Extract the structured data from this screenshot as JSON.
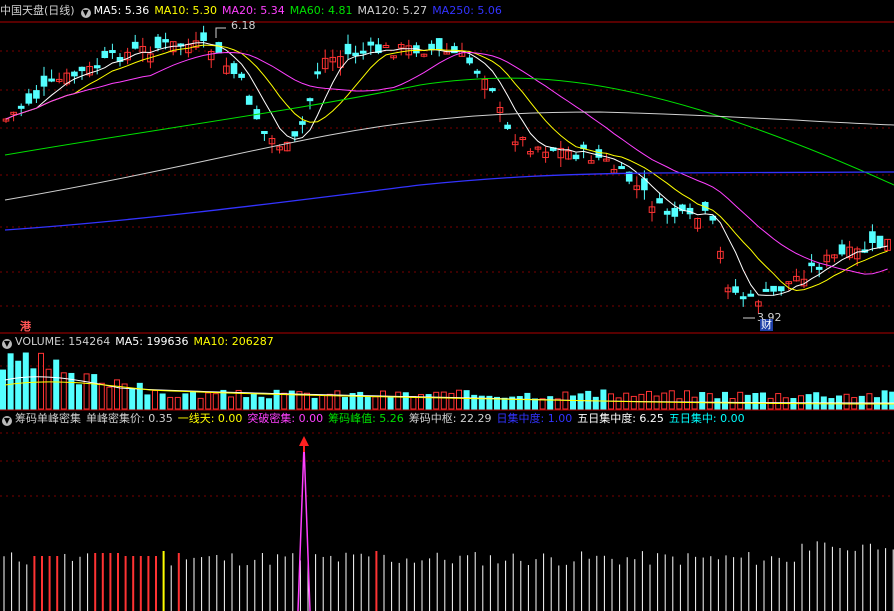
{
  "main": {
    "title": "中国天盘(日线)",
    "ma": [
      {
        "label": "MA5: 5.36",
        "color": "#ffffff"
      },
      {
        "label": "MA10: 5.30",
        "color": "#ffff00"
      },
      {
        "label": "MA20: 5.34",
        "color": "#ff40ff"
      },
      {
        "label": "MA60: 4.81",
        "color": "#00e000"
      },
      {
        "label": "MA120: 5.27",
        "color": "#d0d0d0"
      },
      {
        "label": "MA250: 5.06",
        "color": "#3333ff"
      }
    ],
    "high_label": "6.18",
    "low_label": "3.92",
    "tag_hk": "港",
    "tag_cai": "财"
  },
  "volume": {
    "title": "VOLUME: 154264",
    "ma5": "MA5: 199636",
    "ma10": "MA10: 206287"
  },
  "indicator": {
    "title": "筹码单峰密集",
    "items": [
      {
        "label": "单峰密集价: 0.35",
        "color": "#d0d0d0"
      },
      {
        "label": "一线天: 0.00",
        "color": "#ffff00"
      },
      {
        "label": "突破密集: 0.00",
        "color": "#ff40ff"
      },
      {
        "label": "筹码峰值: 5.26",
        "color": "#00e000"
      },
      {
        "label": "筹码中枢: 22.29",
        "color": "#d0d0d0"
      },
      {
        "label": "日集中度: 1.00",
        "color": "#3333ff"
      },
      {
        "label": "五日集中度: 6.25",
        "color": "#ffffff"
      },
      {
        "label": "五日集中: 0.00",
        "color": "#00ffff"
      }
    ]
  },
  "colors": {
    "up": "#ff3333",
    "down": "#54ffff",
    "panel_border": "#b00000",
    "grid": "#7a0000"
  }
}
